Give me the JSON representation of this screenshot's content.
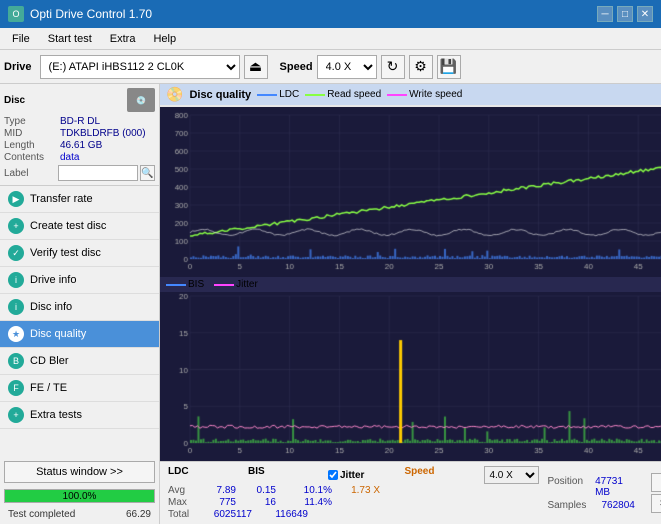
{
  "titlebar": {
    "title": "Opti Drive Control 1.70",
    "icon": "O",
    "minimize": "─",
    "maximize": "□",
    "close": "✕"
  },
  "menubar": {
    "items": [
      "File",
      "Start test",
      "Extra",
      "Help"
    ]
  },
  "toolbar": {
    "drive_label": "Drive",
    "drive_value": "(E:) ATAPI iHBS112  2 CL0K",
    "speed_label": "Speed",
    "speed_value": "4.0 X"
  },
  "disc": {
    "type_label": "Type",
    "type_value": "BD-R DL",
    "mid_label": "MID",
    "mid_value": "TDKBLDRFB (000)",
    "length_label": "Length",
    "length_value": "46.61 GB",
    "contents_label": "Contents",
    "contents_value": "data",
    "label_label": "Label"
  },
  "nav": {
    "items": [
      {
        "id": "transfer-rate",
        "label": "Transfer rate",
        "active": false
      },
      {
        "id": "create-test-disc",
        "label": "Create test disc",
        "active": false
      },
      {
        "id": "verify-test-disc",
        "label": "Verify test disc",
        "active": false
      },
      {
        "id": "drive-info",
        "label": "Drive info",
        "active": false
      },
      {
        "id": "disc-info",
        "label": "Disc info",
        "active": false
      },
      {
        "id": "disc-quality",
        "label": "Disc quality",
        "active": true
      },
      {
        "id": "cd-bler",
        "label": "CD Bler",
        "active": false
      },
      {
        "id": "fe-te",
        "label": "FE / TE",
        "active": false
      },
      {
        "id": "extra-tests",
        "label": "Extra tests",
        "active": false
      }
    ]
  },
  "status": {
    "window_btn": "Status window >>",
    "progress": 100,
    "progress_text": "100.0%",
    "status_text": "Test completed",
    "extra_value": "66.29"
  },
  "disc_quality": {
    "title": "Disc quality",
    "legend": [
      {
        "label": "LDC",
        "color": "#4488ff"
      },
      {
        "label": "Read speed",
        "color": "#88ff44"
      },
      {
        "label": "Write speed",
        "color": "#ff44ff"
      }
    ],
    "legend2": [
      {
        "label": "BIS",
        "color": "#4488ff"
      },
      {
        "label": "Jitter",
        "color": "#ff44ff"
      }
    ]
  },
  "stats": {
    "headers": [
      "LDC",
      "BIS",
      "",
      "Jitter",
      "Speed",
      ""
    ],
    "avg_label": "Avg",
    "max_label": "Max",
    "total_label": "Total",
    "ldc_avg": "7.89",
    "ldc_max": "775",
    "ldc_total": "6025117",
    "bis_avg": "0.15",
    "bis_max": "16",
    "bis_total": "116649",
    "jitter_avg": "10.1%",
    "jitter_max": "11.4%",
    "speed_val": "1.73 X",
    "speed_select": "4.0 X",
    "position_label": "Position",
    "position_val": "47731 MB",
    "samples_label": "Samples",
    "samples_val": "762804",
    "start_full_btn": "Start full",
    "start_part_btn": "Start part"
  }
}
